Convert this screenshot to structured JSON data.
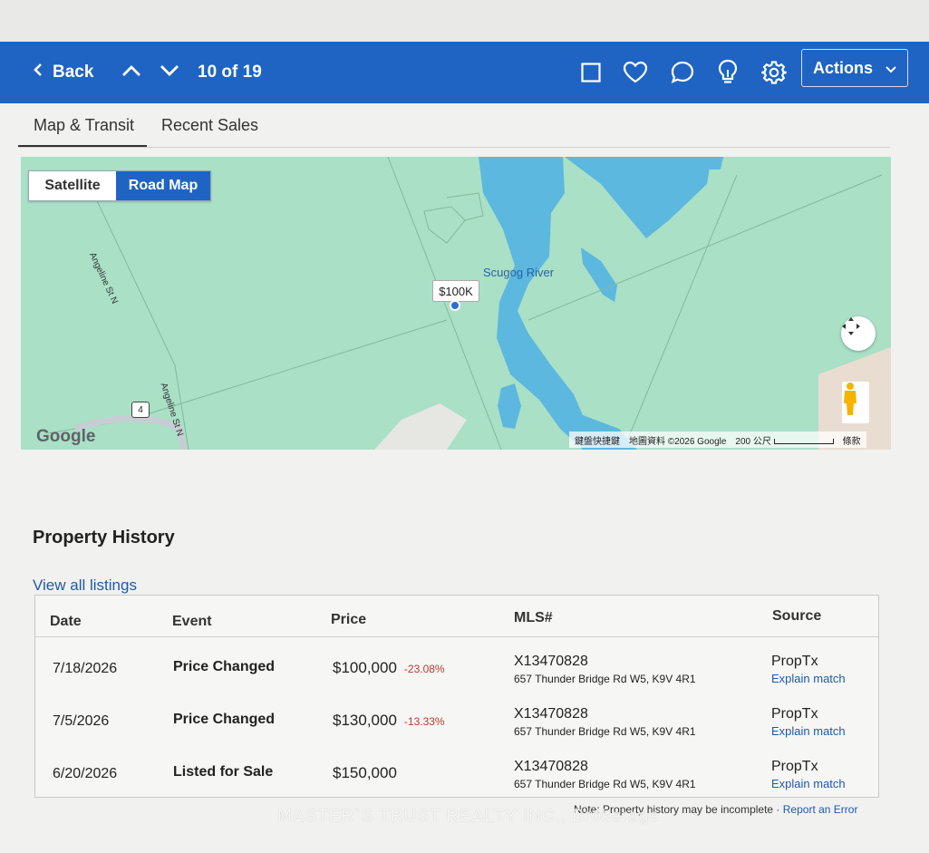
{
  "toolbar": {
    "back_label": "Back",
    "counter": "10 of 19",
    "actions_label": "Actions",
    "icons": [
      "checkbox-icon",
      "heart-icon",
      "chat-icon",
      "lightbulb-icon",
      "gear-icon"
    ]
  },
  "tabs": [
    {
      "label": "Map & Transit",
      "active": true
    },
    {
      "label": "Recent Sales",
      "active": false
    }
  ],
  "map": {
    "type_buttons": {
      "satellite": "Satellite",
      "road": "Road Map",
      "selected": "Road Map"
    },
    "streets": [
      "Angeline St N",
      "Angeline St N"
    ],
    "river_label": "Scugog River",
    "price_pin": "$100K",
    "highway_shield": "4",
    "google_logo": "Google",
    "attribution": {
      "shortcuts": "鍵盤快捷鍵",
      "data": "地圖資料 ©2026 Google",
      "scale": "200 公尺",
      "terms": "條款"
    }
  },
  "history": {
    "title": "Property History",
    "view_all": "View all listings",
    "columns": {
      "date": "Date",
      "event": "Event",
      "price": "Price",
      "mls": "MLS#",
      "source": "Source"
    },
    "rows": [
      {
        "date": "7/18/2026",
        "event": "Price Changed",
        "price": "$100,000",
        "change": "-23.08%",
        "mls": "X13470828",
        "address": "657 Thunder Bridge Rd W5, K9V 4R1",
        "source": "PropTx",
        "source_link": "Explain match"
      },
      {
        "date": "7/5/2026",
        "event": "Price Changed",
        "price": "$130,000",
        "change": "-13.33%",
        "mls": "X13470828",
        "address": "657 Thunder Bridge Rd W5, K9V 4R1",
        "source": "PropTx",
        "source_link": "Explain match"
      },
      {
        "date": "6/20/2026",
        "event": "Listed for Sale",
        "price": "$150,000",
        "change": "",
        "mls": "X13470828",
        "address": "657 Thunder Bridge Rd W5, K9V 4R1",
        "source": "PropTx",
        "source_link": "Explain match"
      }
    ],
    "note": "Note: Property history may be incomplete · ",
    "report_link": "Report an Error"
  },
  "watermark": "MASTER`S TRUST REALTY INC., Brokerage",
  "colors": {
    "toolbar": "#1f64c2",
    "link": "#1f5aa6",
    "negative": "#c0392b",
    "water": "#5cb8df",
    "land": "#a9e0c6"
  }
}
